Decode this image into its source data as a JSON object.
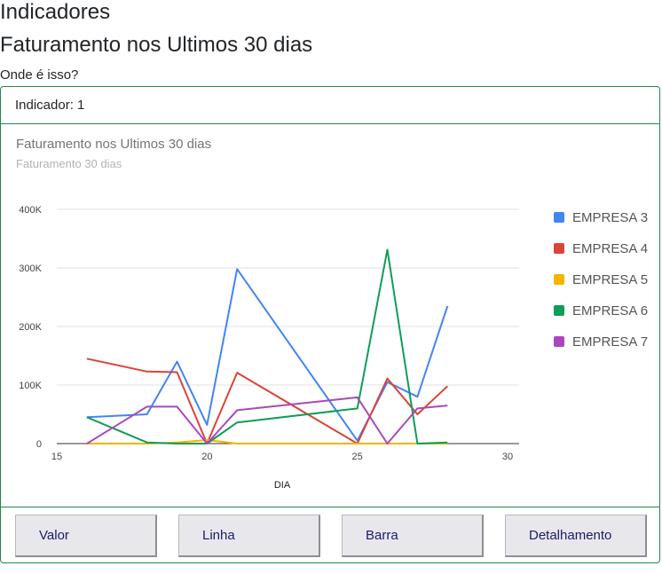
{
  "page": {
    "title": "Indicadores",
    "subtitle": "Faturamento nos Ultimos 30 dias",
    "question": "Onde é isso?"
  },
  "card": {
    "header": "Indicador: 1"
  },
  "buttons": [
    "Valor",
    "Linha",
    "Barra",
    "Detalhamento"
  ],
  "chart_data": {
    "type": "line",
    "title": "Faturamento nos Ultimos 30 dias",
    "subtitle": "Faturamento 30 dias",
    "xlabel": "DIA",
    "ylabel": "",
    "xlim": [
      15,
      30
    ],
    "ylim": [
      0,
      400000
    ],
    "xticks": [
      15,
      20,
      25,
      30
    ],
    "yticks": [
      0,
      100000,
      200000,
      300000,
      400000
    ],
    "ytick_labels": [
      "0",
      "100K",
      "200K",
      "300K",
      "400K"
    ],
    "grid": true,
    "legend_position": "right",
    "series": [
      {
        "name": "EMPRESA 3",
        "color": "#4285f4",
        "x": [
          16,
          18,
          19,
          20,
          21,
          25,
          26,
          27,
          28
        ],
        "y": [
          45000,
          50000,
          140000,
          32000,
          298000,
          5000,
          105000,
          80000,
          235000
        ]
      },
      {
        "name": "EMPRESA 4",
        "color": "#db4437",
        "x": [
          16,
          18,
          19,
          20,
          21,
          25,
          26,
          27,
          28
        ],
        "y": [
          145000,
          123000,
          122000,
          0,
          121000,
          0,
          111000,
          50000,
          98000
        ]
      },
      {
        "name": "EMPRESA 5",
        "color": "#f4b400",
        "x": [
          16,
          18,
          19,
          20,
          21,
          25,
          26,
          27,
          28
        ],
        "y": [
          0,
          0,
          2000,
          6000,
          0,
          0,
          0,
          0,
          0
        ]
      },
      {
        "name": "EMPRESA 6",
        "color": "#0f9d58",
        "x": [
          16,
          18,
          19,
          20,
          21,
          25,
          26,
          27,
          28
        ],
        "y": [
          45000,
          2000,
          0,
          0,
          36000,
          60000,
          331000,
          0,
          2000
        ]
      },
      {
        "name": "EMPRESA 7",
        "color": "#ab47bc",
        "x": [
          16,
          18,
          19,
          20,
          21,
          25,
          26,
          27,
          28
        ],
        "y": [
          0,
          63000,
          63000,
          0,
          57000,
          79000,
          0,
          60000,
          65000
        ]
      }
    ]
  }
}
